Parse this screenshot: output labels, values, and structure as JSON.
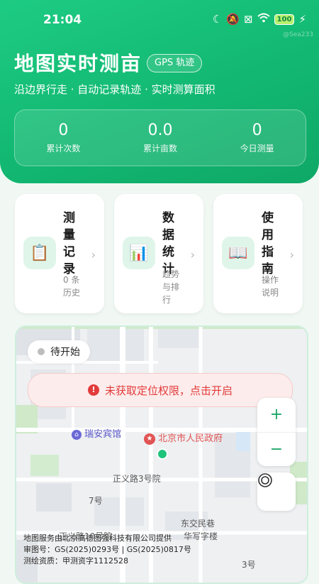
{
  "status_bar": {
    "time": "21:04",
    "battery": "100",
    "watermark": "@Sea233"
  },
  "header": {
    "title": "地图实时测亩",
    "badge": "GPS 轨迹",
    "subtitle": "沿边界行走 · 自动记录轨迹 · 实时测算面积",
    "stats": [
      {
        "value": "0",
        "label": "累计次数"
      },
      {
        "value": "0.0",
        "label": "累计亩数"
      },
      {
        "value": "0",
        "label": "今日测量"
      }
    ]
  },
  "cards": [
    {
      "title": "测量记录",
      "subtitle": "0 条历史",
      "icon": "clipboard-icon"
    },
    {
      "title": "数据统计",
      "subtitle": "趋势与排行",
      "icon": "bar-chart-icon"
    },
    {
      "title": "使用指南",
      "subtitle": "操作说明",
      "icon": "book-icon"
    }
  ],
  "map": {
    "status": "待开始",
    "permission_warning": "未获取定位权限，点击开启",
    "zoom_in": "+",
    "zoom_out": "−",
    "labels": {
      "hotel": "瑞安宾馆",
      "gov": "北京市人民政府",
      "road1": "正义路3号院",
      "road2": "7号",
      "road3": "东交民巷",
      "road4": "华写字楼",
      "road5": "正义路10号院",
      "road6": "3号"
    },
    "copyright": [
      "地图服务由北京高德图强科技有限公司提供",
      "审图号：GS(2025)0293号 | GS(2025)0817号",
      "测绘资质：甲测资字1112528"
    ]
  }
}
